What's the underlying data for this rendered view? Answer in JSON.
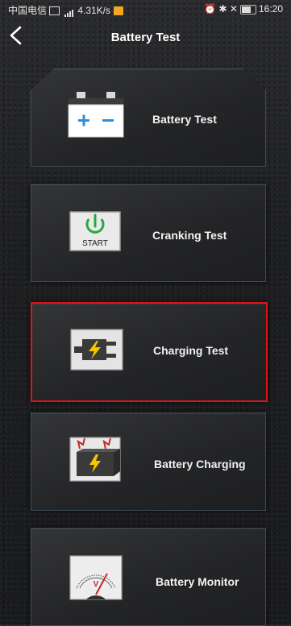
{
  "status_bar": {
    "carrier": "中国电信",
    "speed": "4.31K/s",
    "time": "16:20",
    "battery_level": "65"
  },
  "header": {
    "title": "Battery Test",
    "back_icon": "chevron-left-icon"
  },
  "menu": [
    {
      "label": "Battery Test",
      "icon": "battery-icon",
      "selected": false
    },
    {
      "label": "Cranking Test",
      "icon": "power-start-icon",
      "icon_text": "START",
      "selected": false
    },
    {
      "label": "Charging Test",
      "icon": "plug-lightning-icon",
      "selected": true
    },
    {
      "label": "Battery Charging",
      "icon": "battery-charging-icon",
      "selected": false
    },
    {
      "label": "Battery Monitor",
      "icon": "voltmeter-icon",
      "selected": false
    }
  ],
  "colors": {
    "selected_border": "#e0121c",
    "accent_blue": "#2d8fe0",
    "accent_green": "#27a844",
    "accent_yellow": "#f7c600"
  }
}
